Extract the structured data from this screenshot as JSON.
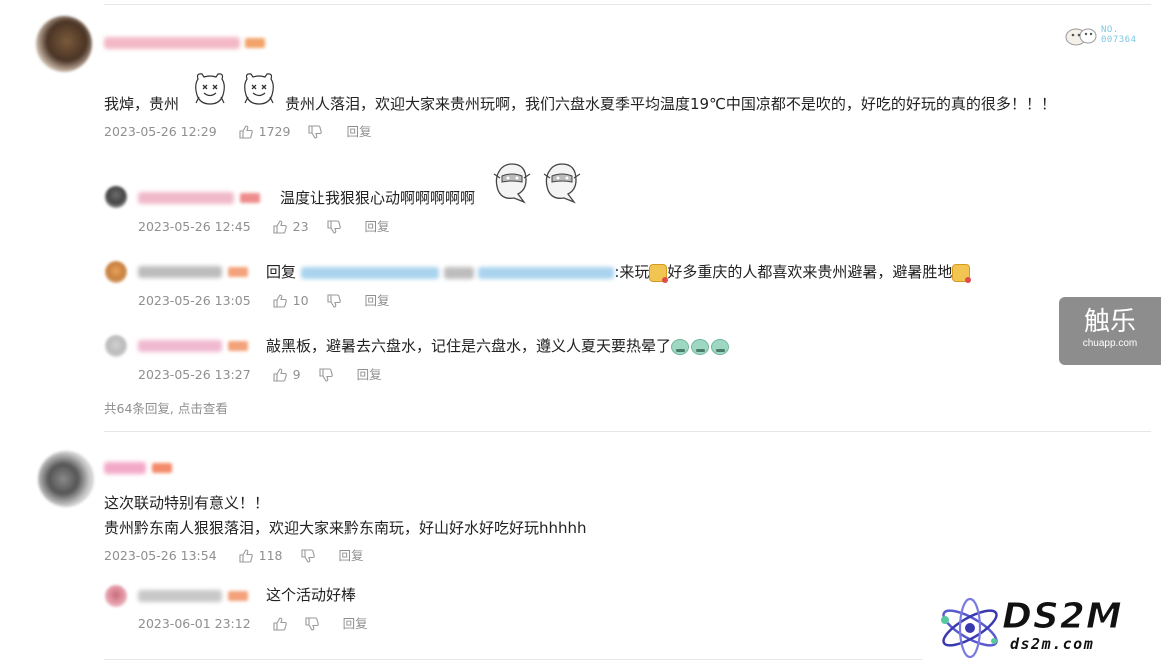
{
  "watermarks": {
    "badge_no_label": "NO.",
    "badge_no_value": "007364",
    "chuapp_big": "触乐",
    "chuapp_small": "chuapp.com",
    "ds2m_title": "DS2M",
    "ds2m_url": "ds2m.com"
  },
  "comments": [
    {
      "text": "我焯，贵州",
      "text_after_emoji": "贵州人落泪，欢迎大家来贵州玩啊，我们六盘水夏季平均温度19℃中国凉都不是吹的，好吃的好玩的真的很多！！！",
      "date": "2023-05-26 12:29",
      "likes": "1729",
      "reply_label": "回复",
      "replies": [
        {
          "text": "温度让我狠狠心动啊啊啊啊啊",
          "date": "2023-05-26 12:45",
          "likes": "23",
          "reply_label": "回复"
        },
        {
          "prefix": "回复",
          "text_mid": ":来玩",
          "text_mid2": "好多重庆的人都喜欢来贵州避暑，避暑胜地",
          "date": "2023-05-26 13:05",
          "likes": "10",
          "reply_label": "回复"
        },
        {
          "text": "敲黑板，避暑去六盘水，记住是六盘水，遵义人夏天要热晕了",
          "date": "2023-05-26 13:27",
          "likes": "9",
          "reply_label": "回复"
        }
      ],
      "more_replies": "共64条回复, 点击查看"
    },
    {
      "text_line1": "这次联动特别有意义！！",
      "text_line2": "贵州黔东南人狠狠落泪，欢迎大家来黔东南玩，好山好水好吃好玩hhhhh",
      "date": "2023-05-26 13:54",
      "likes": "118",
      "reply_label": "回复",
      "replies": [
        {
          "text": "这个活动好棒",
          "date": "2023-06-01 23:12",
          "likes": "",
          "reply_label": "回复"
        }
      ]
    }
  ]
}
